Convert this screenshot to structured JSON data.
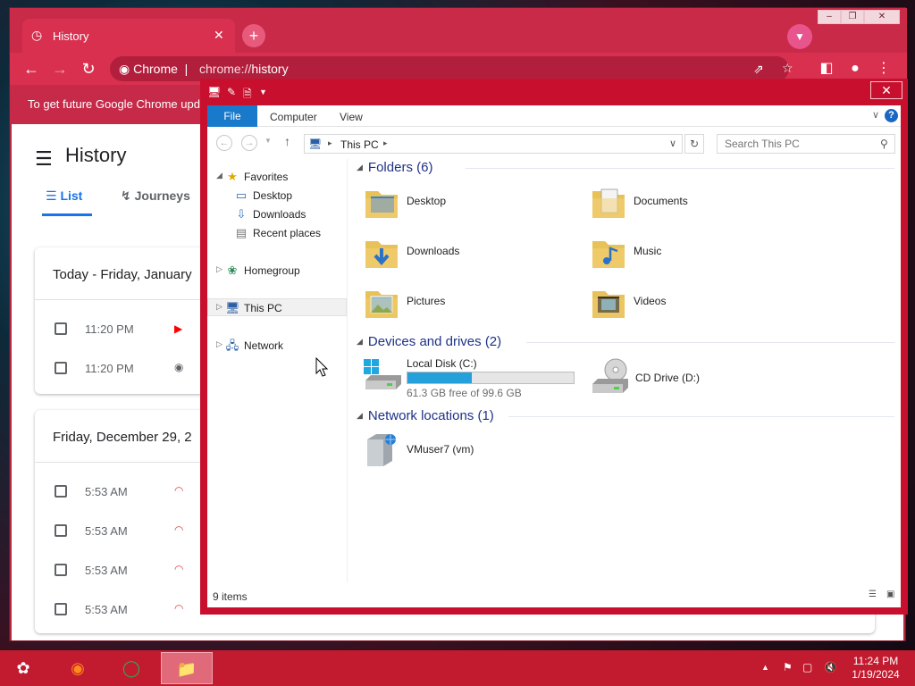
{
  "chrome": {
    "tab_title": "History",
    "tab_close": "✕",
    "new_tab": "+",
    "omnibox_site": "Chrome",
    "omnibox_url_prefix": "chrome://",
    "omnibox_url_path": "history",
    "banner_text": "To get future Google Chrome upd",
    "page_title": "History",
    "tabs": [
      {
        "label": "List"
      },
      {
        "label": "Journeys"
      }
    ],
    "cards": [
      {
        "heading": "Today - Friday, January",
        "rows": [
          {
            "time": "11:20 PM",
            "favicon": "youtube-icon"
          },
          {
            "time": "11:20 PM",
            "favicon": "globe-icon"
          }
        ]
      },
      {
        "heading": "Friday, December 29, 2",
        "rows": [
          {
            "time": "5:53 AM",
            "favicon": "rainbow-icon"
          },
          {
            "time": "5:53 AM",
            "favicon": "rainbow-icon"
          },
          {
            "time": "5:53 AM",
            "favicon": "rainbow-icon"
          },
          {
            "time": "5:53 AM",
            "favicon": "rainbow-icon"
          }
        ]
      }
    ]
  },
  "explorer": {
    "ribbon_tabs": [
      "File",
      "Computer",
      "View"
    ],
    "breadcrumb": "This PC",
    "search_placeholder": "Search This PC",
    "nav": {
      "favorites": "Favorites",
      "desktop": "Desktop",
      "downloads": "Downloads",
      "recent": "Recent places",
      "homegroup": "Homegroup",
      "thispc": "This PC",
      "network": "Network"
    },
    "groups": {
      "folders": "Folders (6)",
      "devices": "Devices and drives (2)",
      "network": "Network locations (1)"
    },
    "folders": [
      "Desktop",
      "Documents",
      "Downloads",
      "Music",
      "Pictures",
      "Videos"
    ],
    "drives": [
      {
        "name": "Local Disk (C:)",
        "free": "61.3 GB free of 99.6 GB",
        "used_fraction": 0.385
      },
      {
        "name": "CD Drive (D:)"
      }
    ],
    "network_locations": [
      "VMuser7 (vm)"
    ],
    "status": "9 items"
  },
  "taskbar": {
    "time": "11:24 PM",
    "date": "1/19/2024"
  },
  "colors": {
    "chrome_frame": "#c92a48",
    "explorer_frame": "#c8102e",
    "accent_blue": "#1a73e8",
    "file_tab": "#1979ca",
    "drive_fill": "#26a0da"
  }
}
